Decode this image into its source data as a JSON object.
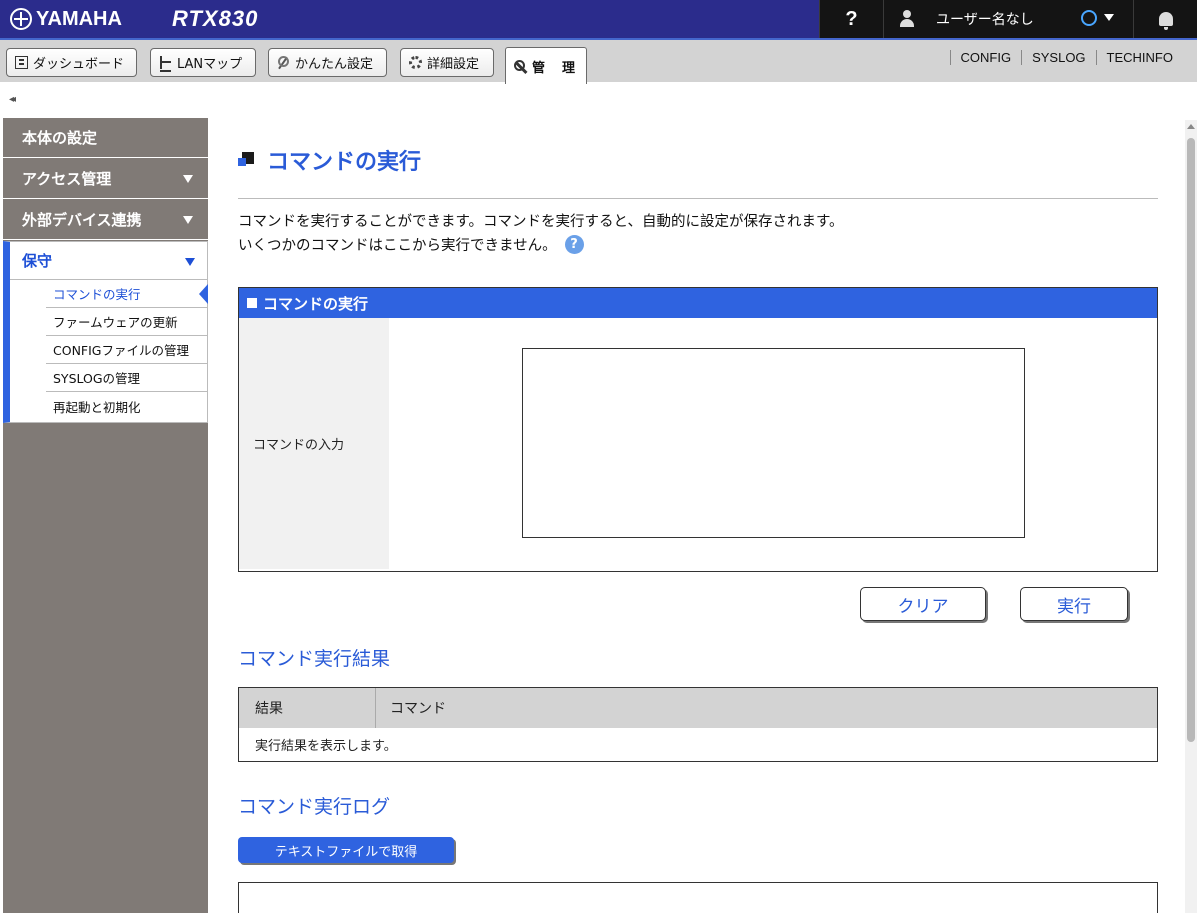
{
  "header": {
    "brand": "YAMAHA",
    "model": "RTX830",
    "help_label": "?",
    "user_label": "ユーザー名なし"
  },
  "tabs": [
    {
      "label": "ダッシュボード",
      "icon": "dashboard-icon"
    },
    {
      "label": "LANマップ",
      "icon": "lan-map-icon"
    },
    {
      "label": "かんたん設定",
      "icon": "magic-wand-icon"
    },
    {
      "label": "詳細設定",
      "icon": "gear-icon"
    },
    {
      "label": "管　理",
      "icon": "wrench-icon",
      "active": true
    }
  ],
  "toplinks": [
    "CONFIG",
    "SYSLOG",
    "TECHINFO"
  ],
  "collapse": "◂◂",
  "sidebar": {
    "items": [
      {
        "label": "本体の設定"
      },
      {
        "label": "アクセス管理"
      },
      {
        "label": "外部デバイス連携"
      }
    ],
    "active": {
      "label": "保守",
      "subitems": [
        {
          "label": "コマンドの実行",
          "current": true
        },
        {
          "label": "ファームウェアの更新"
        },
        {
          "label": "CONFIGファイルの管理"
        },
        {
          "label": "SYSLOGの管理"
        },
        {
          "label": "再起動と初期化"
        }
      ]
    }
  },
  "main": {
    "title": "コマンドの実行",
    "desc1": "コマンドを実行することができます。コマンドを実行すると、自動的に設定が保存されます。",
    "desc2": "いくつかのコマンドはここから実行できません。",
    "help_icon": "?",
    "panel": {
      "title": "コマンドの実行",
      "input_label": "コマンドの入力",
      "input_value": ""
    },
    "buttons": {
      "clear": "クリア",
      "run": "実行"
    },
    "results": {
      "heading": "コマンド実行結果",
      "col_result": "結果",
      "col_command": "コマンド",
      "placeholder_row": "実行結果を表示します。"
    },
    "log": {
      "heading": "コマンド実行ログ",
      "download_button": "テキストファイルで取得"
    }
  },
  "colors": {
    "header_bg": "#2b2c8c",
    "accent": "#2f63e0",
    "sidebar_bg": "#807a76",
    "title_text": "#2a5bd7"
  }
}
